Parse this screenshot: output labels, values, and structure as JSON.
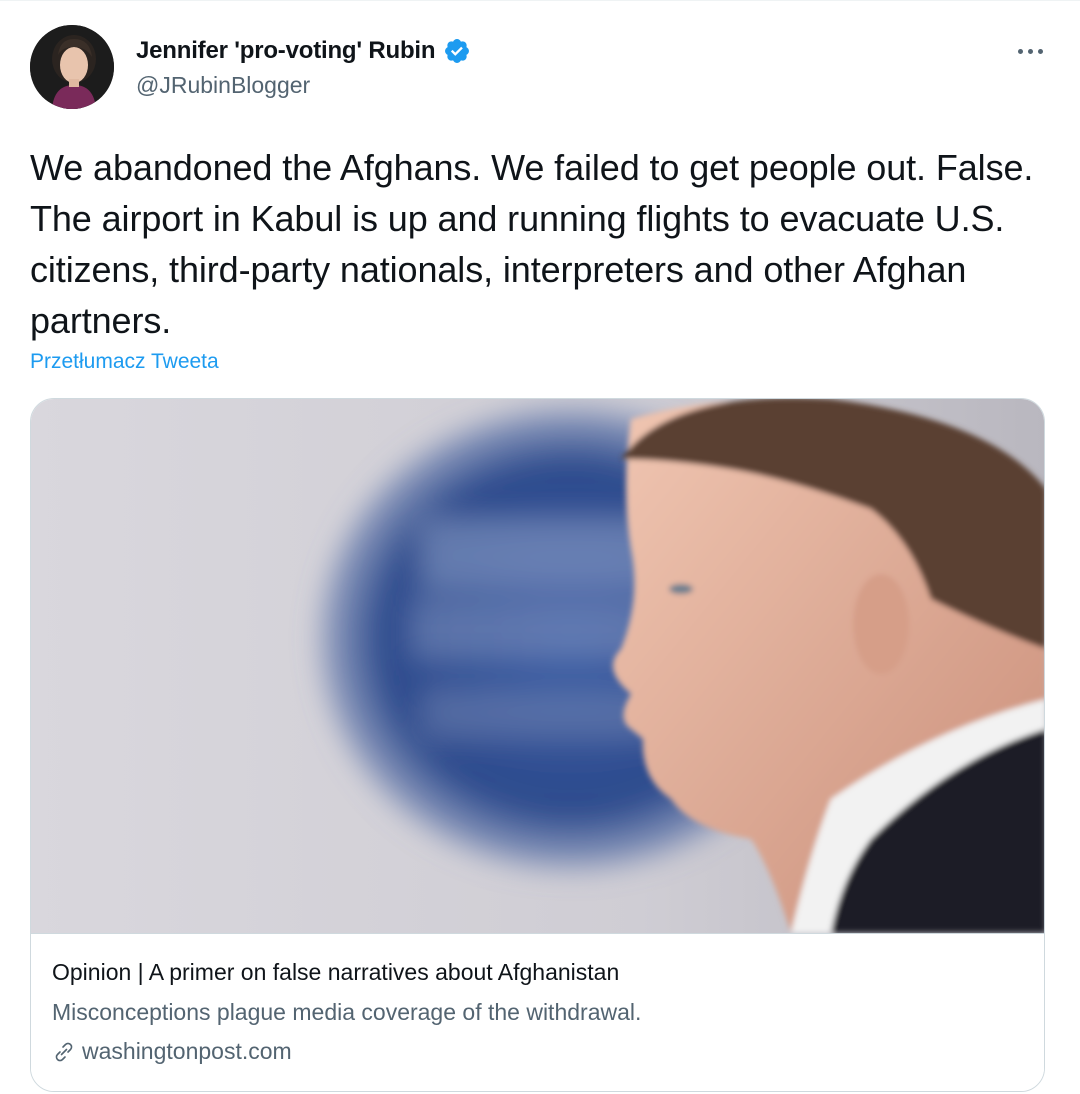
{
  "author": {
    "name": "Jennifer 'pro-voting' Rubin",
    "handle": "@JRubinBlogger",
    "verified": true
  },
  "tweet": {
    "text": "We abandoned the Afghans. We failed to get people out. False. The airport in Kabul is up and running flights to evacuate U.S. citizens, third-party nationals, interpreters and other Afghan partners.",
    "translate_label": "Przetłumacz Tweeta"
  },
  "card": {
    "title": "Opinion | A primer on false narratives about Afghanistan",
    "description": "Misconceptions plague media coverage of the withdrawal.",
    "domain": "washingtonpost.com"
  },
  "icons": {
    "verified": "verified-badge-icon",
    "more": "more-horizontal-icon",
    "link": "link-icon"
  },
  "colors": {
    "accent": "#1d9bf0",
    "text": "#0f1419",
    "secondary": "#536471",
    "border": "#cfd9de"
  }
}
